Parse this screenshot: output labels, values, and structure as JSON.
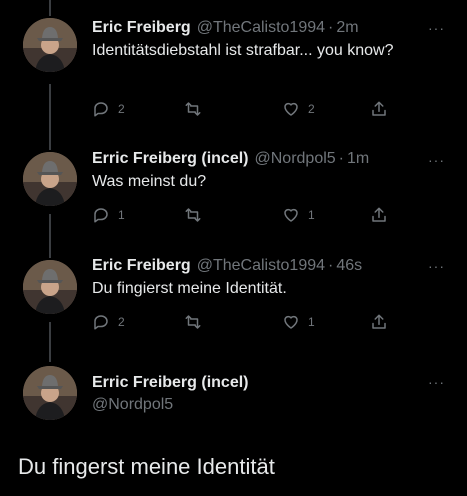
{
  "tweets": [
    {
      "name": "Eric Freiberg",
      "handle": "@TheCalisto1994",
      "time": "2m",
      "text": "Identitätsdiebstahl ist strafbar... you know?",
      "replies": "2",
      "retweets": "",
      "likes": "2"
    },
    {
      "name": "Erric Freiberg (incel)",
      "handle": "@Nordpol5",
      "time": "1m",
      "text": "Was meinst du?",
      "replies": "1",
      "retweets": "",
      "likes": "1"
    },
    {
      "name": "Eric Freiberg",
      "handle": "@TheCalisto1994",
      "time": "46s",
      "text": "Du fingierst meine Identität.",
      "replies": "2",
      "retweets": "",
      "likes": "1"
    }
  ],
  "focused": {
    "name": "Erric Freiberg (incel)",
    "handle": "@Nordpol5",
    "text": "Du fingerst meine Identität"
  },
  "separator": "·",
  "more": "···",
  "icons": {
    "reply": "reply-icon",
    "retweet": "retweet-icon",
    "like": "heart-icon",
    "share": "share-icon"
  },
  "colors": {
    "background": "#000000",
    "text": "#e7e9ea",
    "muted": "#71767b",
    "line": "#3a3d41"
  }
}
